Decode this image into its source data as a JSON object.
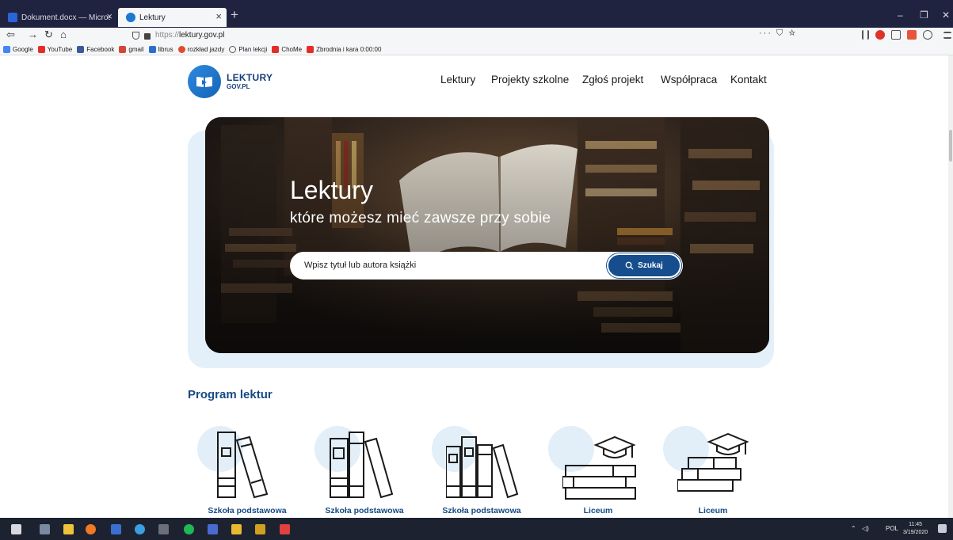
{
  "browser": {
    "tabs": [
      {
        "title": "Dokument.docx — Microsoft Word"
      },
      {
        "title": "Lektury"
      }
    ],
    "new_tab": "+",
    "url_prefix": "https://",
    "url_host": "lektury.gov.pl",
    "url_actions": "··· ⛉ ☆",
    "bookmarks": [
      {
        "label": "Google",
        "color": "#4285f4"
      },
      {
        "label": "YouTube",
        "color": "#e52d27"
      },
      {
        "label": "Facebook",
        "color": "#3b5998"
      },
      {
        "label": "gmail",
        "color": "#d44638"
      },
      {
        "label": "librus",
        "color": "#2a6fcf"
      },
      {
        "label": "rozkład jazdy",
        "color": "#e04b2a"
      },
      {
        "label": "Plan lekcji",
        "color": "#555555"
      },
      {
        "label": "ChoMe",
        "color": "#e52d27"
      },
      {
        "label": "Zbrodnia i kara 0:00:00",
        "color": "#e52d27"
      }
    ]
  },
  "site": {
    "logo_line1": "LEKTURY",
    "logo_line2": "GOV.PL",
    "nav": [
      "Lektury",
      "Projekty szkolne",
      "Zgłoś projekt",
      "Współpraca",
      "Kontakt"
    ],
    "hero_title": "Lektury",
    "hero_subtitle": "które możesz mieć zawsze przy sobie",
    "search_placeholder": "Wpisz tytuł lub autora książki",
    "search_button": "Szukaj",
    "program_title": "Program lektur",
    "cards": [
      {
        "label": "Szkoła podstawowa"
      },
      {
        "label": "Szkoła podstawowa"
      },
      {
        "label": "Szkoła podstawowa"
      },
      {
        "label": "Liceum"
      },
      {
        "label": "Liceum"
      }
    ]
  },
  "taskbar": {
    "lang": "POL",
    "time": "11:45",
    "date": "3/19/2020"
  }
}
